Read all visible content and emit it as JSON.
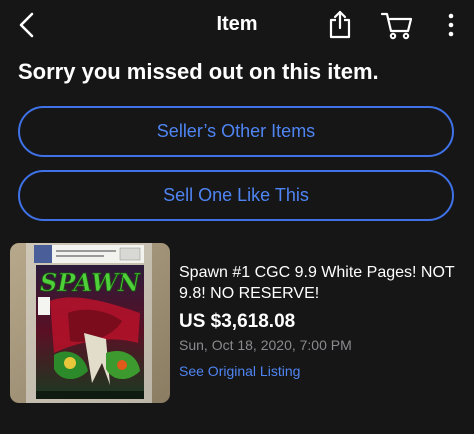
{
  "nav": {
    "title": "Item",
    "icons": [
      "back-chevron-icon",
      "share-icon",
      "cart-icon",
      "more-vertical-icon"
    ]
  },
  "heading": "Sorry you missed out on this item.",
  "buttons": {
    "seller_items": "Seller’s Other Items",
    "sell_one": "Sell One Like This"
  },
  "listing": {
    "title": "Spawn #1 CGC 9.9 White Pages! NOT 9.8! NO RESERVE!",
    "price": "US $3,618.08",
    "date": "Sun, Oct 18, 2020, 7:00 PM",
    "link": "See Original Listing",
    "comic_logo": "SPAWN"
  },
  "colors": {
    "background": "#161616",
    "accent": "#3f72e8",
    "muted_text": "#8a8a8e"
  }
}
